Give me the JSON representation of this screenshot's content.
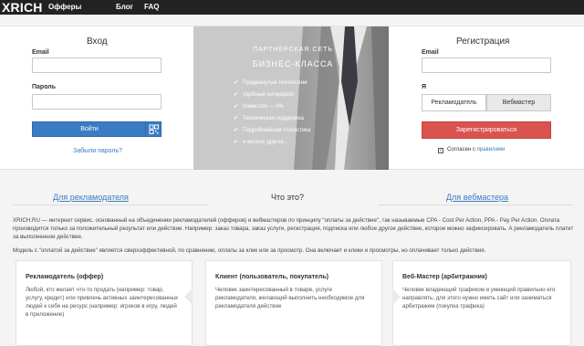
{
  "brand": {
    "logo": "XRICH"
  },
  "nav": {
    "offers": "Офферы",
    "blog": "Блог",
    "faq": "FAQ"
  },
  "login": {
    "title": "Вход",
    "email_label": "Email",
    "password_label": "Пароль",
    "email_value": "",
    "password_value": "",
    "submit_label": "Войти",
    "forgot_link": "Забыли пароль?"
  },
  "promo": {
    "heading": "ПАРТНЕРСКАЯ СЕТЬ",
    "subheading": "БИЗНЕС-КЛАССА",
    "features": [
      "Продвинутые технологии",
      "Удобный интерфейс",
      "Комиссия — 0%",
      "Техническая поддержка",
      "Подробнейшая статистика",
      "и многое другое..."
    ]
  },
  "register": {
    "title": "Регистрация",
    "email_label": "Email",
    "email_value": "",
    "role_label": "Я",
    "roles": [
      "Рекламодатель",
      "Вебмастер"
    ],
    "selected_role": "Вебмастер",
    "submit_label": "Зарегистрироваться",
    "agree_prefix": "Согласен с ",
    "agree_link": "правилами",
    "agree_checked": true
  },
  "info": {
    "tab_advertisers": "Для рекламодателя",
    "tab_what": "Что это?",
    "tab_webmasters": "Для вебмастера",
    "paragraph_1": "XRICH.RU — интернет сервис, основанный на объединении рекламодателей (офферов) и вебмастеров по принципу \"оплаты за действие\", так называемые CPA - Cost Per Action, PPA - Pay Per Action. Оплата производится только за положительный результат или действие. Например: заказ товара, заказ услуги, регистрация, подписка или любое другое действие, которое можно зафиксировать. А рекламодатель платит за выполненное действие.",
    "paragraph_2": "Модель с \"оплатой за действие\" является сверхэффективной, по сравнению, оплаты за клик или за просмотр. Она включает и клики и просмотры, но оплачивает только действия."
  },
  "cards": [
    {
      "title": "Рекламодатель (оффер)",
      "text": "Любой, кто желает что-то продать (например: товар, услугу, кредит) или привлечь активных заинтересованных людей к себе на ресурс (например: игроков в игру, людей в приложение)"
    },
    {
      "title": "Клиент (пользователь, покупатель)",
      "text": "Человек заинтересованный в товаре, услуге рекламодателя, желающий выполнить необходимое для рекламодателя действие"
    },
    {
      "title": "Веб-Мастер (арбитражник)",
      "text": "Человек владеющий трафиком и умеющий правильно его направлять, для этого нужно иметь сайт или заниматься арбитражем (покупка трафика)"
    }
  ],
  "colors": {
    "topbar": "#222222",
    "login_button": "#3a7cc3",
    "register_button": "#d9534f",
    "link": "#3a7cc3"
  },
  "icons": {
    "login_extra": "qr-code-icon",
    "feature_bullet": "check-icon",
    "agree": "checkbox-icon"
  }
}
